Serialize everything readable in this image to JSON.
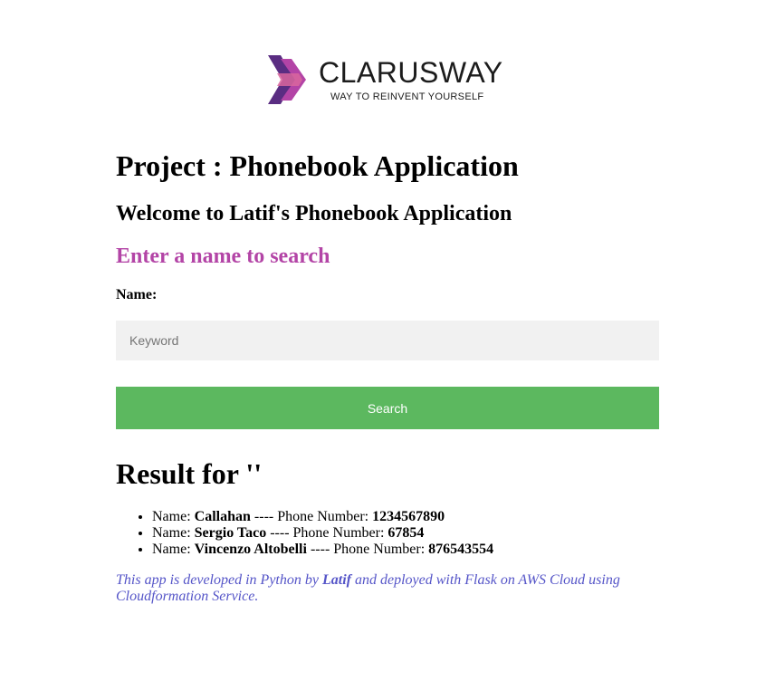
{
  "logo": {
    "name": "CLARUSWAY",
    "tagline": "WAY TO REINVENT YOURSELF",
    "icon": "chevron-arrows-logo-icon",
    "colors": {
      "dark_purple": "#5a2d82",
      "magenta": "#b344a6",
      "pink": "#d9669e"
    }
  },
  "page": {
    "project_title": "Project : Phonebook Application",
    "welcome_title": "Welcome to Latif's Phonebook Application",
    "search_heading": "Enter a name to search",
    "search_heading_color": "#b344a6"
  },
  "form": {
    "name_label": "Name:",
    "keyword_placeholder": "Keyword",
    "keyword_value": "",
    "search_button_label": "Search",
    "search_button_color": "#5cb85f"
  },
  "results": {
    "title": "Result for ''",
    "name_prefix": "Name: ",
    "phone_prefix": " ---- Phone Number: ",
    "items": [
      {
        "name": "Callahan",
        "phone": "1234567890"
      },
      {
        "name": "Sergio Taco",
        "phone": "67854"
      },
      {
        "name": "Vincenzo Altobelli",
        "phone": "876543554"
      }
    ]
  },
  "footer": {
    "text_before": "This app is developed in Python by ",
    "author": "Latif",
    "text_after": " and deployed with Flask on AWS Cloud using Cloudformation Service.",
    "color": "#5555c8"
  }
}
